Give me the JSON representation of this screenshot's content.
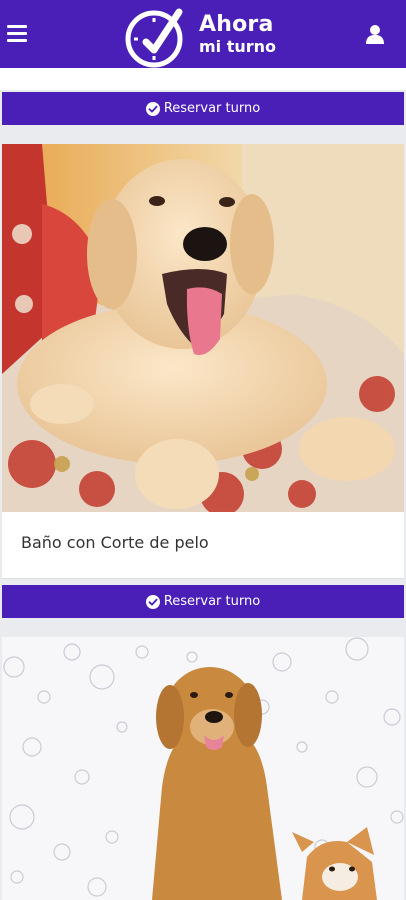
{
  "header": {
    "brand_line1": "Ahora",
    "brand_line2": "mi turno",
    "menu_icon": "hamburger-menu-icon",
    "user_icon": "user-icon",
    "logo_icon": "clock-check-icon",
    "color": "#4a1fb8"
  },
  "services": [
    {
      "reserve_label": "Reservar turno"
    },
    {
      "title": "Baño con Corte de pelo",
      "reserve_label": "Reservar turno",
      "image": "puppy-on-sofa-photo"
    },
    {
      "image": "dogs-with-bubbles-photo"
    }
  ]
}
